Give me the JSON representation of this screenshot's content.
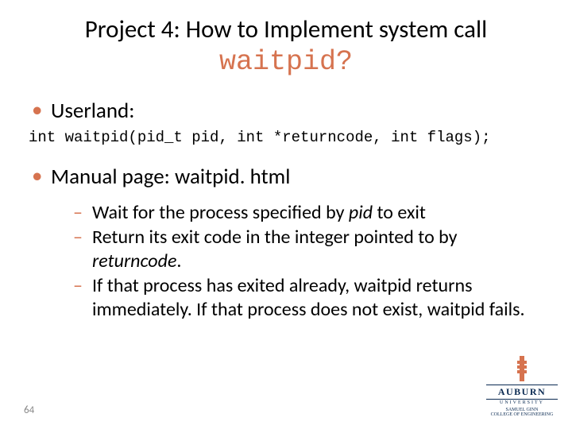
{
  "title": {
    "line1": "Project 4: How to Implement system call",
    "code": "waitpid?"
  },
  "userland_label": "Userland:",
  "codeblock": "int waitpid(pid_t pid, int *returncode, int flags);",
  "manual_label": "Manual page: waitpid. html",
  "dash1_a": "Wait for the process specified by ",
  "dash1_pid": "pid",
  "dash1_b": " to exit",
  "dash2_a": "Return its exit code in the integer pointed to by ",
  "dash2_rc": "returncode",
  "dash2_b": ".",
  "dash3": "If that process has exited already, waitpid returns immediately. If that process does not exist, waitpid fails.",
  "page_num": "64",
  "logo": {
    "name": "AUBURN",
    "sub": "UNIVERSITY",
    "college1": "SAMUEL GINN",
    "college2": "COLLEGE OF ENGINEERING"
  }
}
